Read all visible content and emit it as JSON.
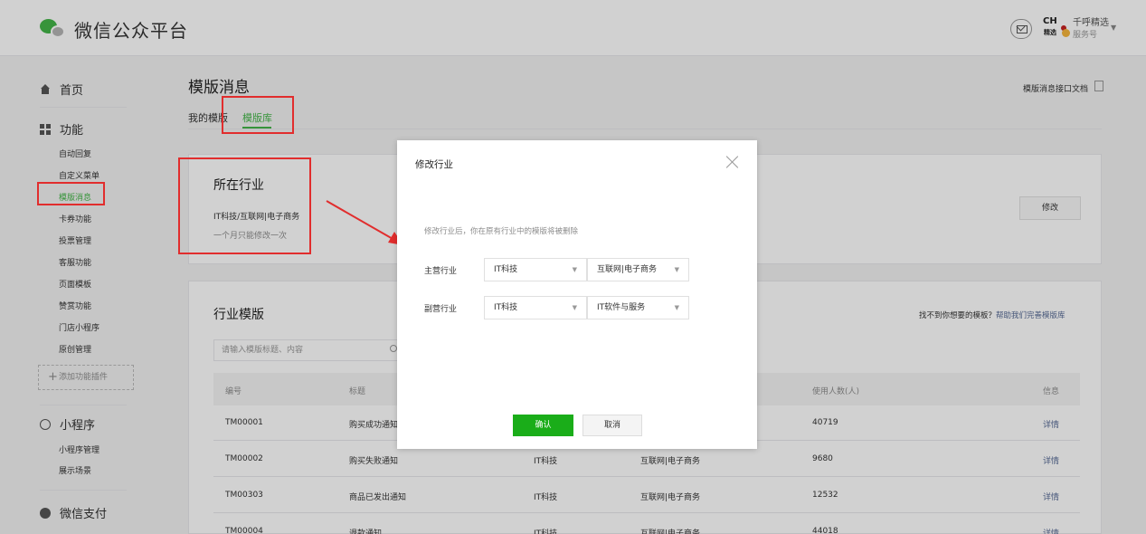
{
  "header": {
    "logo_text": "微信公众平台",
    "account_logo_top": "CH",
    "account_logo_bottom": "精选",
    "account_name": "千呼精选",
    "account_type": "服务号"
  },
  "sidebar": {
    "home": "首页",
    "features": "功能",
    "feature_items": [
      "自动回复",
      "自定义菜单",
      "模版消息",
      "卡券功能",
      "投票管理",
      "客服功能",
      "页面模板",
      "赞赏功能",
      "门店小程序",
      "原创管理"
    ],
    "add_plugin": "添加功能插件",
    "miniprogram": "小程序",
    "miniprogram_items": [
      "小程序管理",
      "展示场景"
    ],
    "wechat_pay": "微信支付"
  },
  "main": {
    "title": "模版消息",
    "api_doc": "模版消息接口文档",
    "tabs": [
      "我的模版",
      "模版库"
    ],
    "industry": {
      "title": "所在行业",
      "value": "IT科技/互联网|电子商务",
      "note": "一个月只能修改一次",
      "edit": "修改"
    },
    "templates": {
      "title": "行业模版",
      "help_prefix": "找不到你想要的模板？",
      "help_link": "帮助我们完善模版库",
      "search_placeholder": "请输入模版标题、内容",
      "columns": [
        "编号",
        "标题",
        "",
        "",
        "使用人数(人)",
        "信息"
      ],
      "rows": [
        [
          "TM00001",
          "购买成功通知",
          "",
          "",
          "40719",
          "详情"
        ],
        [
          "TM00002",
          "购买失败通知",
          "IT科技",
          "互联网|电子商务",
          "9680",
          "详情"
        ],
        [
          "TM00303",
          "商品已发出通知",
          "IT科技",
          "互联网|电子商务",
          "12532",
          "详情"
        ],
        [
          "TM00004",
          "退款通知",
          "IT科技",
          "互联网|电子商务",
          "44018",
          "详情"
        ]
      ]
    }
  },
  "dialog": {
    "title": "修改行业",
    "message": "修改行业后，你在原有行业中的模版将被删除",
    "primary_label": "主营行业",
    "primary_values": [
      "IT科技",
      "互联网|电子商务"
    ],
    "secondary_label": "副营行业",
    "secondary_values": [
      "IT科技",
      "IT软件与服务"
    ],
    "confirm": "确认",
    "cancel": "取消"
  },
  "colors": {
    "brand_green": "#44b549",
    "confirm_green": "#1aad19",
    "link_blue": "#576b95",
    "annotation_red": "#e12d2d"
  }
}
